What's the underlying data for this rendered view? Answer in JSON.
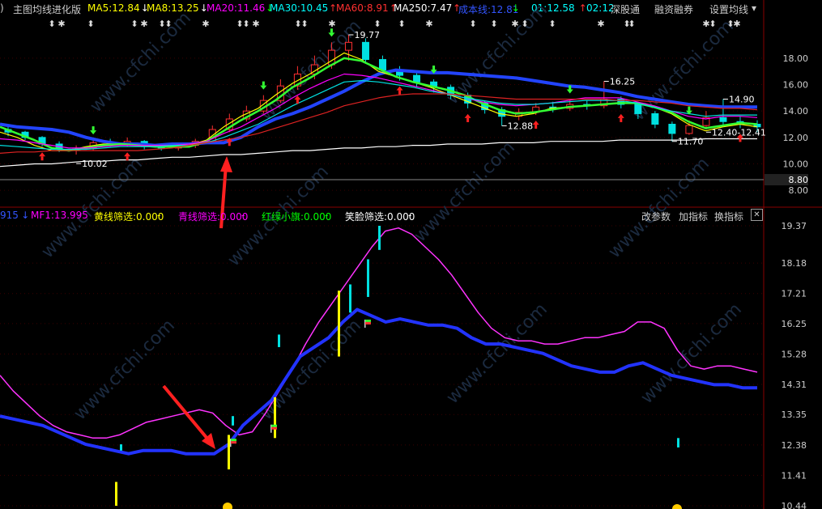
{
  "top_bar": {
    "prefix": ")",
    "title": "主图均线进化版",
    "items": [
      {
        "label": "MA5:12.84",
        "arrow": "↓",
        "color": "#ffff00",
        "arrow_color": "#ffffff"
      },
      {
        "label": "MA8:13.25",
        "arrow": "↓",
        "color": "#ffff00",
        "arrow_color": "#ffffff"
      },
      {
        "label": "MA20:11.46",
        "arrow": "↓",
        "color": "#ff00ff",
        "arrow_color": "#00ff00"
      },
      {
        "label": "MA30:10.45",
        "arrow": "↑",
        "color": "#00ffff",
        "arrow_color": "#ff3030"
      },
      {
        "label": "MA60:8.91",
        "arrow": "↑",
        "color": "#ff3030",
        "arrow_color": "#ff3030"
      },
      {
        "label": "MA250:7.47",
        "arrow": "↑",
        "color": "#ffffff",
        "arrow_color": "#ff3030"
      },
      {
        "label": "成本线:12.81",
        "arrow": "↓",
        "color": "#3355ff",
        "arrow_color": "#00ff00"
      },
      {
        "label": "01:12.58",
        "arrow": "↑",
        "color": "#00ffff",
        "arrow_color": "#ff3030"
      },
      {
        "label": "02:12",
        "arrow": "",
        "color": "#00ffff",
        "arrow_color": "#ffffff"
      }
    ],
    "buttons": [
      "深股通",
      "融资融券",
      "设置均线"
    ]
  },
  "mid_bar": {
    "items": [
      {
        "label": "915",
        "arrow": "↓",
        "color": "#3355ff"
      },
      {
        "label": "MF1:13.995",
        "arrow": "",
        "color": "#ff00ff"
      },
      {
        "label": "黄线筛选:0.000",
        "arrow": "-",
        "color": "#ffff00"
      },
      {
        "label": "青线筛选:0.000",
        "arrow": "-",
        "color": "#ff00ff"
      },
      {
        "label": "红绿小旗:0.000",
        "arrow": "-",
        "color": "#00ff00"
      },
      {
        "label": "笑脸筛选:0.000",
        "arrow": "-",
        "color": "#ffffff"
      }
    ],
    "buttons": [
      "改参数",
      "加指标",
      "换指标"
    ],
    "close_icon": "close-icon"
  },
  "watermark": "www.cfchi.com",
  "chart_data": [
    {
      "type": "candlestick",
      "y_axis_ticks": [
        "18.00",
        "16.00",
        "14.00",
        "12.00",
        "10.00",
        "8.00"
      ],
      "current_price_label": "8.80",
      "ylim": [
        7.7,
        20.2
      ],
      "annotations": [
        {
          "text": "19.77",
          "price": 19.77
        },
        {
          "text": "16.25",
          "price": 16.25
        },
        {
          "text": "14.90",
          "price": 14.9
        },
        {
          "text": "12.88",
          "price": 12.88
        },
        {
          "text": "12.40-12.41",
          "price": 12.4
        },
        {
          "text": "11.70",
          "price": 11.7
        },
        {
          "text": "10.02",
          "price": 10.02
        }
      ],
      "ma_lines": [
        {
          "name": "成本线",
          "color": "#2244ff",
          "values": [
            13.0,
            12.8,
            12.7,
            12.6,
            12.4,
            12.0,
            11.7,
            11.5,
            11.5,
            11.4,
            11.5,
            11.5,
            11.6,
            11.6,
            12.0,
            12.8,
            13.4,
            13.8,
            14.3,
            14.9,
            15.5,
            16.2,
            16.8,
            17.1,
            17.0,
            16.9,
            16.9,
            16.8,
            16.7,
            16.6,
            16.5,
            16.3,
            16.1,
            15.9,
            15.8,
            15.6,
            15.4,
            15.1,
            14.9,
            14.7,
            14.5,
            14.4,
            14.3,
            14.3,
            14.3
          ]
        },
        {
          "name": "MA5",
          "color": "#ffff00",
          "values": [
            12.4,
            12.0,
            11.4,
            11.0,
            11.0,
            11.3,
            11.5,
            11.5,
            11.4,
            11.3,
            11.3,
            11.4,
            11.8,
            12.8,
            13.6,
            14.2,
            15.2,
            16.1,
            16.8,
            17.6,
            18.4,
            17.9,
            17.0,
            16.6,
            16.2,
            15.8,
            15.3,
            14.8,
            14.3,
            13.8,
            13.6,
            13.8,
            14.2,
            14.3,
            14.4,
            14.5,
            14.6,
            14.6,
            14.3,
            13.8,
            13.0,
            12.5,
            12.8,
            13.0,
            12.8
          ]
        },
        {
          "name": "MA8",
          "color": "#33ff33",
          "values": [
            12.8,
            12.3,
            11.8,
            11.2,
            11.0,
            11.2,
            11.4,
            11.5,
            11.4,
            11.3,
            11.3,
            11.3,
            11.7,
            12.5,
            13.3,
            14.0,
            14.8,
            15.8,
            16.5,
            17.3,
            18.0,
            17.8,
            17.2,
            16.6,
            16.2,
            15.9,
            15.6,
            15.2,
            14.6,
            14.1,
            13.8,
            13.9,
            14.1,
            14.3,
            14.4,
            14.5,
            14.6,
            14.6,
            14.3,
            13.9,
            13.2,
            12.7,
            12.9,
            13.1,
            13.0
          ]
        },
        {
          "name": "MA20",
          "color": "#ff00ff",
          "values": [
            11.9,
            11.8,
            11.6,
            11.4,
            11.2,
            11.2,
            11.3,
            11.4,
            11.4,
            11.4,
            11.4,
            11.5,
            11.7,
            12.3,
            12.8,
            13.5,
            14.2,
            15.0,
            15.7,
            16.3,
            16.8,
            16.7,
            16.5,
            16.2,
            15.9,
            15.6,
            15.3,
            15.0,
            14.7,
            14.5,
            14.4,
            14.5,
            14.6,
            14.8,
            15.0,
            15.0,
            15.0,
            14.7,
            14.4,
            14.0,
            13.6,
            13.4,
            13.6,
            13.6,
            13.5
          ]
        },
        {
          "name": "MA30",
          "color": "#00e0e0",
          "values": [
            11.4,
            11.3,
            11.2,
            11.1,
            11.1,
            11.1,
            11.2,
            11.3,
            11.3,
            11.3,
            11.4,
            11.4,
            11.6,
            12.0,
            12.5,
            13.0,
            13.7,
            14.4,
            15.0,
            15.6,
            16.2,
            16.3,
            16.2,
            16.0,
            15.8,
            15.5,
            15.3,
            15.0,
            14.8,
            14.6,
            14.5,
            14.5,
            14.6,
            14.7,
            14.8,
            14.8,
            14.8,
            14.6,
            14.3,
            14.0,
            13.8,
            13.6,
            13.7,
            13.7,
            13.7
          ]
        },
        {
          "name": "MA60",
          "color": "#dd2222",
          "values": [
            10.8,
            10.9,
            10.9,
            11.0,
            11.0,
            11.0,
            11.0,
            11.0,
            11.0,
            11.1,
            11.2,
            11.4,
            11.6,
            11.8,
            12.0,
            12.3,
            12.7,
            13.1,
            13.5,
            13.9,
            14.4,
            14.7,
            15.0,
            15.2,
            15.3,
            15.3,
            15.3,
            15.2,
            15.1,
            15.0,
            14.9,
            14.9,
            14.9,
            14.9,
            14.9,
            14.9,
            14.8,
            14.8,
            14.7,
            14.6,
            14.4,
            14.3,
            14.2,
            14.2,
            14.1
          ]
        },
        {
          "name": "MA250",
          "color": "#ffffff",
          "values": [
            9.8,
            9.9,
            10.0,
            10.0,
            10.1,
            10.2,
            10.2,
            10.3,
            10.3,
            10.4,
            10.5,
            10.5,
            10.6,
            10.7,
            10.7,
            10.8,
            10.9,
            11.0,
            11.0,
            11.1,
            11.2,
            11.2,
            11.3,
            11.3,
            11.4,
            11.4,
            11.5,
            11.5,
            11.5,
            11.6,
            11.6,
            11.6,
            11.7,
            11.7,
            11.7,
            11.7,
            11.8,
            11.8,
            11.8,
            11.8,
            11.8,
            11.9,
            11.9,
            11.9,
            11.9
          ]
        }
      ],
      "candles": [
        [
          12.6,
          12.4,
          12.8,
          12.1
        ],
        [
          12.4,
          12.0,
          12.5,
          11.8
        ],
        [
          12.0,
          11.5,
          12.1,
          11.3
        ],
        [
          11.5,
          11.1,
          11.7,
          10.9
        ],
        [
          11.1,
          11.2,
          11.4,
          10.7
        ],
        [
          11.2,
          11.6,
          11.8,
          11.0
        ],
        [
          11.6,
          11.5,
          11.9,
          11.3
        ],
        [
          11.5,
          11.7,
          12.0,
          11.3
        ],
        [
          11.7,
          11.3,
          11.8,
          11.1
        ],
        [
          11.3,
          11.2,
          11.5,
          11.0
        ],
        [
          11.2,
          11.4,
          11.6,
          11.0
        ],
        [
          11.4,
          11.7,
          11.9,
          11.2
        ],
        [
          11.7,
          12.6,
          12.9,
          11.6
        ],
        [
          12.6,
          13.4,
          13.8,
          12.4
        ],
        [
          13.4,
          14.0,
          14.4,
          13.2
        ],
        [
          14.0,
          14.8,
          15.2,
          13.8
        ],
        [
          14.8,
          15.9,
          16.4,
          14.6
        ],
        [
          15.9,
          16.8,
          17.4,
          15.6
        ],
        [
          16.8,
          17.5,
          18.2,
          16.4
        ],
        [
          17.5,
          18.6,
          19.2,
          17.2
        ],
        [
          18.6,
          19.2,
          19.77,
          17.8
        ],
        [
          19.2,
          17.9,
          19.5,
          17.6
        ],
        [
          17.9,
          17.1,
          18.2,
          16.8
        ],
        [
          17.1,
          16.7,
          17.4,
          16.3
        ],
        [
          16.7,
          16.2,
          16.9,
          15.8
        ],
        [
          16.2,
          15.8,
          16.4,
          15.4
        ],
        [
          15.8,
          15.2,
          16.0,
          14.9
        ],
        [
          15.2,
          14.6,
          15.4,
          14.2
        ],
        [
          14.6,
          14.1,
          14.8,
          13.8
        ],
        [
          14.1,
          13.6,
          14.3,
          12.88
        ],
        [
          13.6,
          13.9,
          14.2,
          13.3
        ],
        [
          13.9,
          14.3,
          14.6,
          13.7
        ],
        [
          14.3,
          14.2,
          14.7,
          13.9
        ],
        [
          14.2,
          14.5,
          14.9,
          14.0
        ],
        [
          14.5,
          14.4,
          14.8,
          14.1
        ],
        [
          14.4,
          14.9,
          16.25,
          14.2
        ],
        [
          14.9,
          14.5,
          15.1,
          14.2
        ],
        [
          14.5,
          13.8,
          14.7,
          13.4
        ],
        [
          13.8,
          13.0,
          14.0,
          12.7
        ],
        [
          13.0,
          12.3,
          13.2,
          11.7
        ],
        [
          12.3,
          12.9,
          13.3,
          12.2
        ],
        [
          12.9,
          13.5,
          14.0,
          12.6
        ],
        [
          13.5,
          13.2,
          14.9,
          12.9
        ],
        [
          13.2,
          13.0,
          13.6,
          12.7
        ],
        [
          13.0,
          12.8,
          13.3,
          12.4
        ]
      ]
    },
    {
      "type": "line",
      "y_axis_ticks": [
        "19.37",
        "18.18",
        "17.21",
        "16.25",
        "15.28",
        "14.31",
        "13.35",
        "12.38",
        "11.41",
        "10.44"
      ],
      "ylim": [
        10.44,
        19.37
      ],
      "series": [
        {
          "name": "MF1",
          "color": "#ff33ff",
          "values": [
            14.6,
            14.1,
            13.7,
            13.3,
            13.0,
            12.8,
            12.7,
            12.6,
            12.6,
            12.7,
            12.9,
            13.1,
            13.2,
            13.3,
            13.4,
            13.5,
            13.4,
            13.0,
            12.7,
            12.8,
            13.4,
            14.1,
            14.8,
            15.6,
            16.3,
            16.9,
            17.5,
            18.1,
            18.7,
            19.2,
            19.3,
            19.1,
            18.7,
            18.3,
            17.8,
            17.2,
            16.6,
            16.1,
            15.8,
            15.7,
            15.7,
            15.6,
            15.6,
            15.7,
            15.8,
            15.8,
            15.9,
            16.0,
            16.3,
            16.3,
            16.1,
            15.4,
            14.9,
            14.8,
            14.9,
            14.9,
            14.8,
            14.7
          ]
        },
        {
          "name": "915",
          "color": "#2233ff",
          "values": [
            13.3,
            13.2,
            13.1,
            13.0,
            12.8,
            12.6,
            12.4,
            12.3,
            12.2,
            12.1,
            12.2,
            12.2,
            12.2,
            12.1,
            12.1,
            12.1,
            12.4,
            13.0,
            13.4,
            13.8,
            14.5,
            15.2,
            15.5,
            15.8,
            16.3,
            16.7,
            16.5,
            16.3,
            16.4,
            16.3,
            16.2,
            16.2,
            16.1,
            15.8,
            15.6,
            15.6,
            15.5,
            15.4,
            15.3,
            15.1,
            14.9,
            14.8,
            14.7,
            14.7,
            14.9,
            15.0,
            14.8,
            14.6,
            14.5,
            14.4,
            14.3,
            14.3,
            14.2,
            14.2
          ]
        }
      ],
      "yellow_bars": [
        [
          11.2,
          10.44
        ],
        [
          12.7,
          11.6
        ],
        [
          13.9,
          12.6
        ],
        [
          17.3,
          15.2
        ]
      ],
      "cyan_bars": [
        [
          12.4,
          12.2
        ],
        [
          13.3,
          13.0
        ],
        [
          15.9,
          15.5
        ],
        [
          17.5,
          16.6
        ],
        [
          18.3,
          17.1
        ],
        [
          19.37,
          18.6
        ],
        [
          12.6,
          12.3
        ]
      ]
    }
  ]
}
